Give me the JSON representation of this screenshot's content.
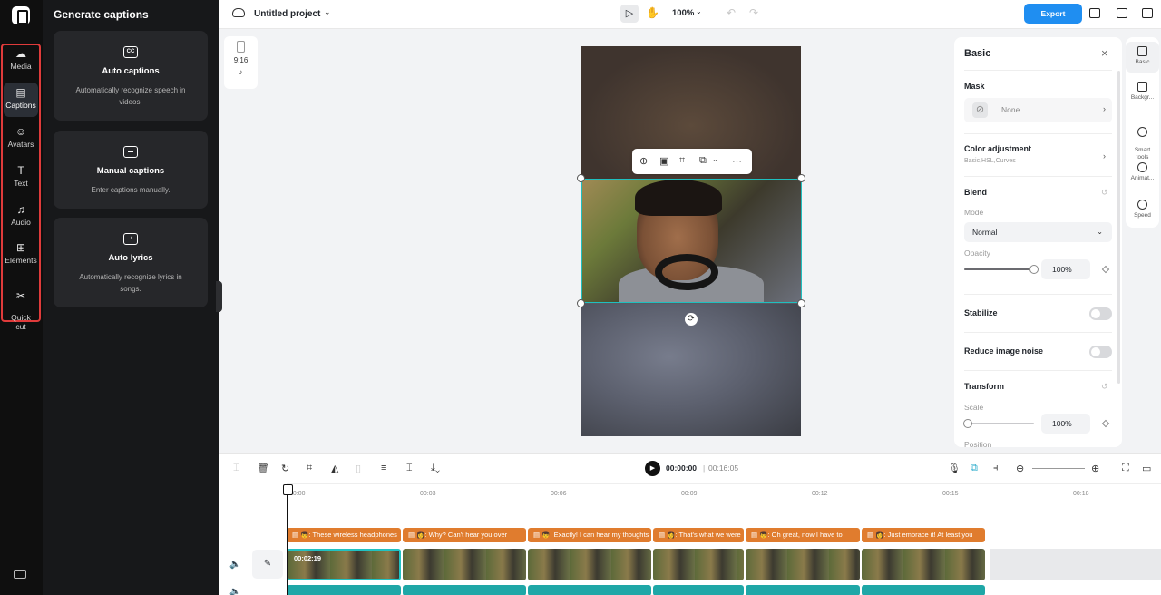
{
  "app": {
    "project_title": "Untitled project",
    "zoom": "100%",
    "export_label": "Export"
  },
  "rail": {
    "items": [
      {
        "label": "Media",
        "icon": "cloud-upload-icon",
        "glyph": "☁"
      },
      {
        "label": "Captions",
        "icon": "captions-icon",
        "glyph": "▤"
      },
      {
        "label": "Avatars",
        "icon": "avatar-icon",
        "glyph": "☺"
      },
      {
        "label": "Text",
        "icon": "text-icon",
        "glyph": "T"
      },
      {
        "label": "Audio",
        "icon": "music-icon",
        "glyph": "♫"
      },
      {
        "label": "Elements",
        "icon": "elements-icon",
        "glyph": "⊞"
      },
      {
        "label": "Quick\ncut",
        "icon": "quick-cut-icon",
        "glyph": "✂"
      }
    ],
    "active": "Captions"
  },
  "panel": {
    "title": "Generate captions",
    "cards": [
      {
        "title": "Auto captions",
        "desc": "Automatically recognize speech in videos.",
        "icon": "cc-icon",
        "glyph": "CC"
      },
      {
        "title": "Manual captions",
        "desc": "Enter captions manually.",
        "icon": "keyboard-icon",
        "glyph": "▬"
      },
      {
        "title": "Auto lyrics",
        "desc": "Automatically recognize lyrics in songs.",
        "icon": "lyrics-scan-icon",
        "glyph": "♪"
      }
    ]
  },
  "canvas": {
    "ratio": "9:16",
    "platform_icon": "tiktok-icon"
  },
  "inspector": {
    "title": "Basic",
    "mask": {
      "label": "Mask",
      "value": "None"
    },
    "color": {
      "label": "Color adjustment",
      "sub": "Basic,HSL,Curves"
    },
    "blend": {
      "label": "Blend",
      "mode_label": "Mode",
      "mode": "Normal",
      "opacity_label": "Opacity",
      "opacity": "100%",
      "opacity_value": 1.0
    },
    "stabilize": {
      "label": "Stabilize",
      "on": false
    },
    "noise": {
      "label": "Reduce image noise",
      "on": false
    },
    "transform": {
      "label": "Transform",
      "scale_label": "Scale",
      "scale": "100%",
      "scale_value": 0.05,
      "position_label": "Position"
    }
  },
  "side_tabs": [
    {
      "label": "Basic",
      "icon": "basic-icon"
    },
    {
      "label": "Backgr...",
      "icon": "background-icon"
    },
    {
      "label": "Smart\ntools",
      "icon": "smart-tools-icon"
    },
    {
      "label": "Animat...",
      "icon": "animation-icon"
    },
    {
      "label": "Speed",
      "icon": "speed-icon"
    }
  ],
  "timeline": {
    "current_time": "00:00:00",
    "total_time": "00:16:05",
    "ruler": [
      "00:00",
      "00:03",
      "00:06",
      "00:09",
      "00:12",
      "00:15",
      "00:18"
    ],
    "captions": [
      "👦: These wireless headphones",
      "👩: Why? Can't hear you over",
      "👦: Exactly! I can hear my thoughts",
      "👩: That's what we were",
      "👦: Oh great, now I have to",
      "👩: Just embrace it! At least you"
    ],
    "clip_duration": "00:02:19"
  }
}
